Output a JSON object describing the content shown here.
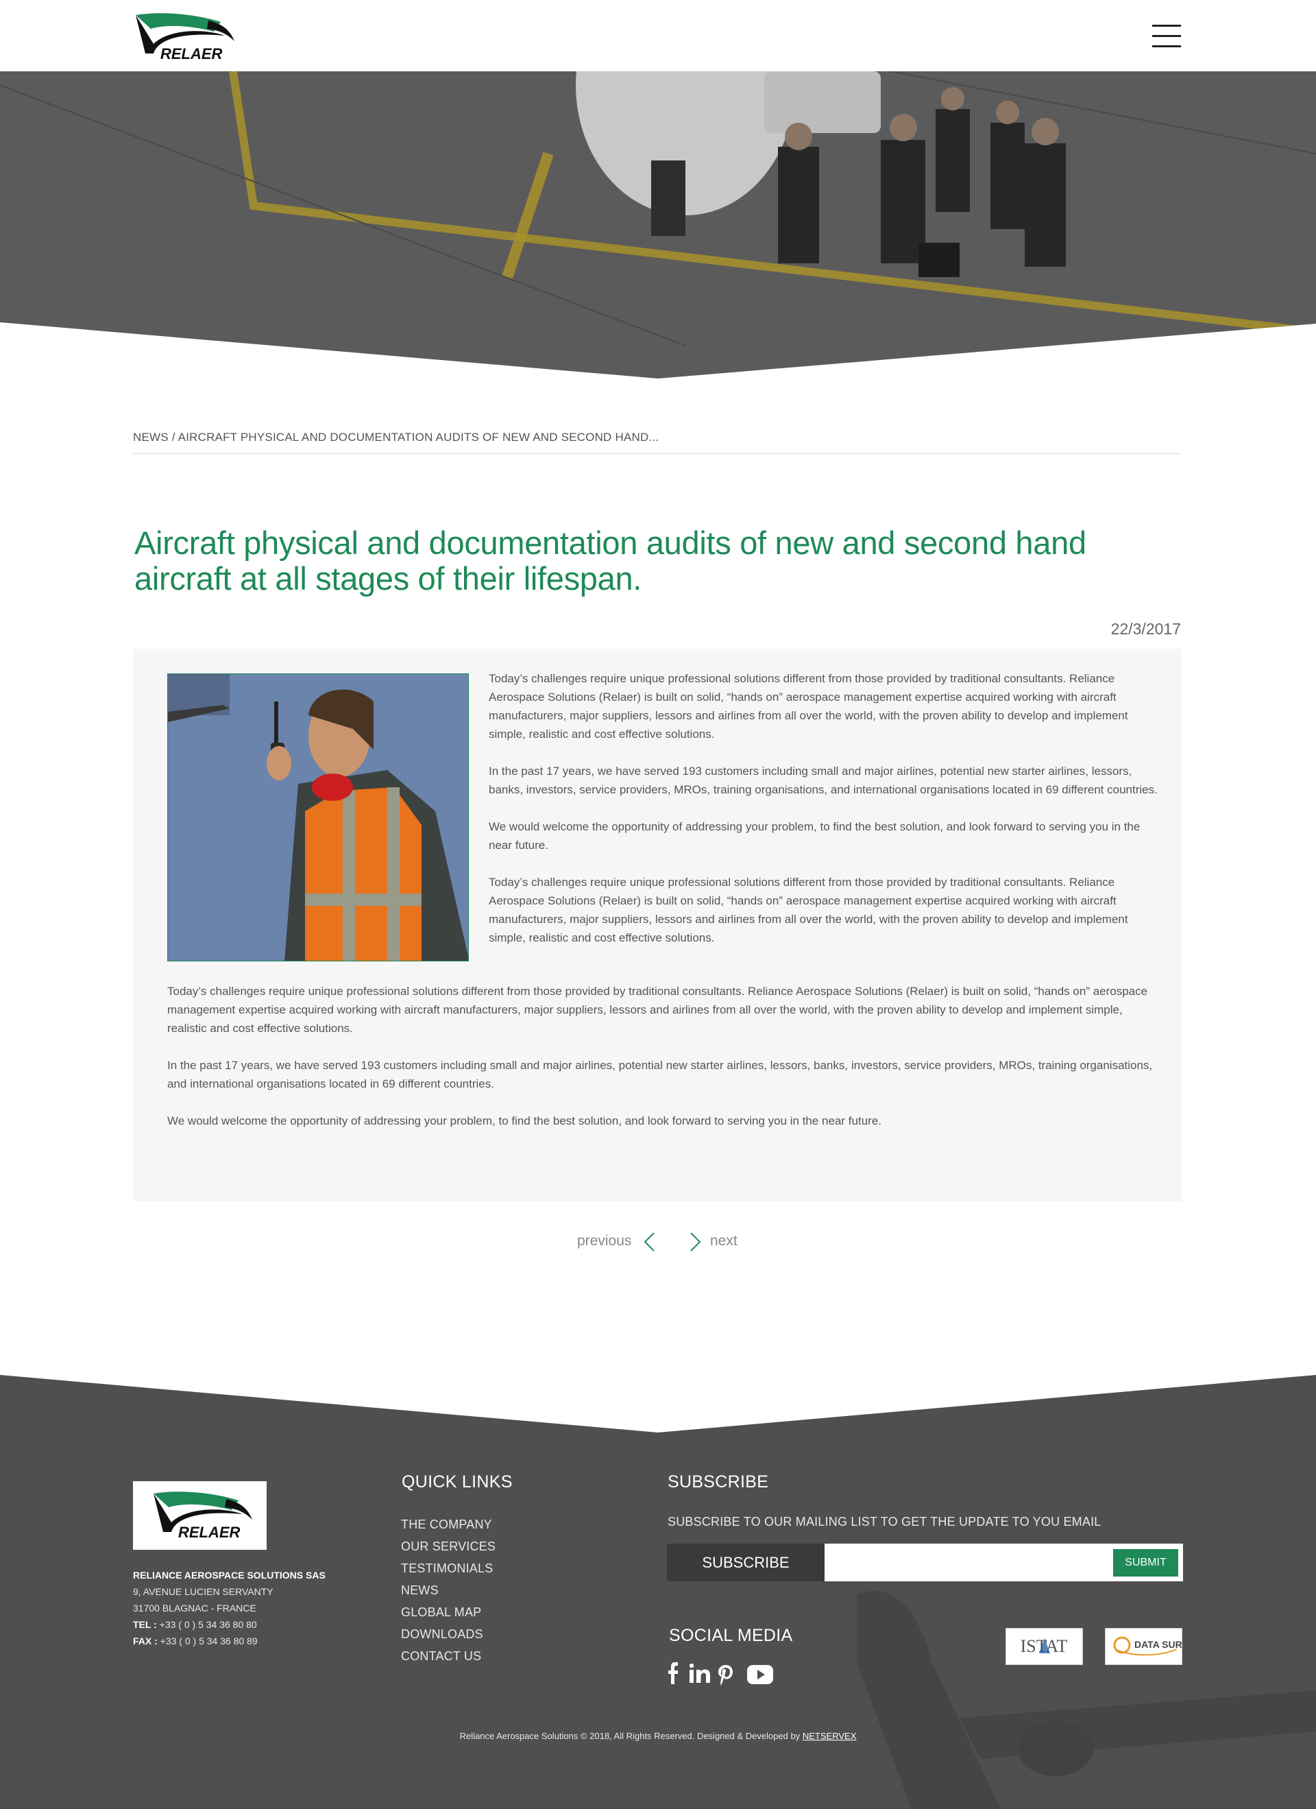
{
  "brand": {
    "name": "RELAER",
    "primary_color": "#1e8a57"
  },
  "header": {
    "menu_icon": "hamburger-menu-icon"
  },
  "breadcrumb": {
    "section": "NEWS",
    "separator": " / ",
    "current": "AIRCRAFT PHYSICAL AND DOCUMENTATION AUDITS OF NEW AND SECOND HAND..."
  },
  "article": {
    "title": "Aircraft physical and documentation audits of new and second hand aircraft at all stages of their lifespan.",
    "date": "22/3/2017",
    "side_paragraphs": [
      "Today’s challenges require unique professional solutions different from those provided by traditional consultants.  Reliance Aerospace Solutions (Relaer) is built on solid, “hands on” aerospace management expertise acquired working with aircraft manufacturers, major suppliers, lessors and airlines from all over the world, with the proven ability to develop and implement simple, realistic and cost effective solutions.",
      "In the past 17 years, we have served 193 customers including small and major airlines, potential new starter airlines, lessors, banks, investors, service providers, MROs, training organisations, and international organisations located in 69 different countries.",
      "We would welcome the opportunity of addressing your problem, to find the best solution, and look forward to serving you in the near future.",
      " Today’s challenges require unique professional solutions different from those provided by traditional consultants.  Reliance Aerospace Solutions (Relaer) is built on solid, “hands on” aerospace management expertise acquired working with aircraft manufacturers, major suppliers, lessors and airlines from all over the world, with the proven ability to develop and implement simple, realistic and cost effective solutions."
    ],
    "full_paragraphs": [
      "Today’s challenges require unique professional solutions different from those provided by traditional consultants.  Reliance Aerospace Solutions (Relaer) is built on solid, “hands on” aerospace management expertise acquired working with aircraft manufacturers, major suppliers, lessors and airlines from all over the world, with the proven ability to develop and implement simple, realistic and cost effective solutions.",
      "In the past 17 years, we have served 193 customers including small and major airlines, potential new starter airlines, lessors, banks, investors, service providers, MROs, training organisations, and international organisations located in 69 different countries.",
      "We would welcome the opportunity of addressing your problem, to find the best solution, and look forward to serving you in the near future."
    ]
  },
  "pager": {
    "previous": "previous",
    "next": "next"
  },
  "footer": {
    "company": {
      "name": "RELIANCE AEROSPACE SOLUTIONS SAS",
      "address1": "9, AVENUE LUCIEN SERVANTY",
      "address2": "31700 BLAGNAC - FRANCE",
      "tel_label": "TEL : ",
      "tel": "+33 ( 0 ) 5 34 36 80 80",
      "fax_label": "FAX : ",
      "fax": "+33 ( 0 ) 5 34 36 80 89"
    },
    "quick_links": {
      "heading": "QUICK LINKS",
      "items": [
        "THE COMPANY",
        "OUR SERVICES",
        "TESTIMONIALS",
        "NEWS",
        "GLOBAL MAP",
        "DOWNLOADS",
        "CONTACT US"
      ]
    },
    "subscribe": {
      "heading": "SUBSCRIBE",
      "text": "SUBSCRIBE TO OUR MAILING LIST TO GET THE UPDATE TO YOU EMAIL",
      "label": "SUBSCRIBE",
      "input_value": "",
      "button": "SUBMIT"
    },
    "social": {
      "heading": "SOCIAL MEDIA",
      "icons": [
        "facebook-icon",
        "linkedin-icon",
        "pinterest-icon",
        "youtube-icon"
      ]
    },
    "partners": [
      "ISTAT",
      "DATA SURE"
    ],
    "copyright": "Reliance Aerospace Solutions © 2018, All Rights Reserved. Designed & Developed by ",
    "developer": "NETSERVEX"
  }
}
